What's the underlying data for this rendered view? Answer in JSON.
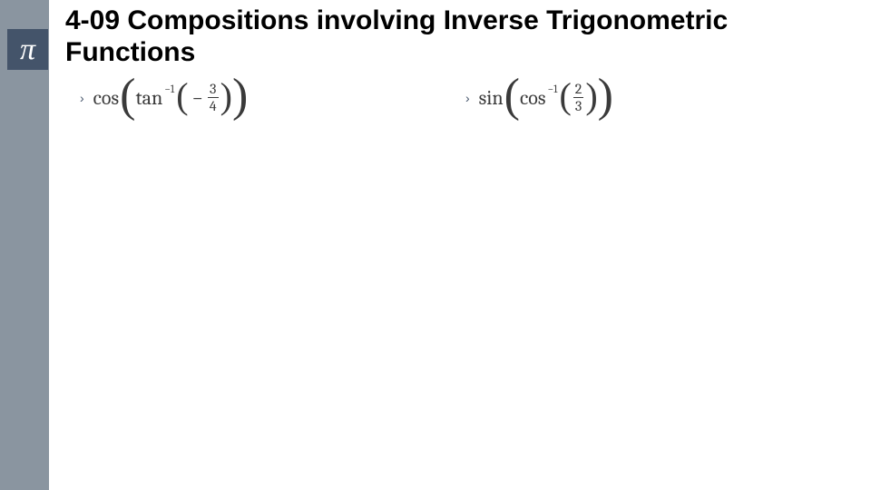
{
  "sidebar": {
    "pi_glyph": "π"
  },
  "title": "4-09 Compositions involving Inverse Trigonometric Functions",
  "content": {
    "columns": [
      {
        "bullet": "›",
        "outer_fn": "cos",
        "inner_fn": "tan",
        "inverse_exp": "−1",
        "sign": "−",
        "frac": {
          "num": "3",
          "den": "4"
        }
      },
      {
        "bullet": "›",
        "outer_fn": "sin",
        "inner_fn": "cos",
        "inverse_exp": "−1",
        "sign": "",
        "frac": {
          "num": "2",
          "den": "3"
        }
      }
    ]
  }
}
